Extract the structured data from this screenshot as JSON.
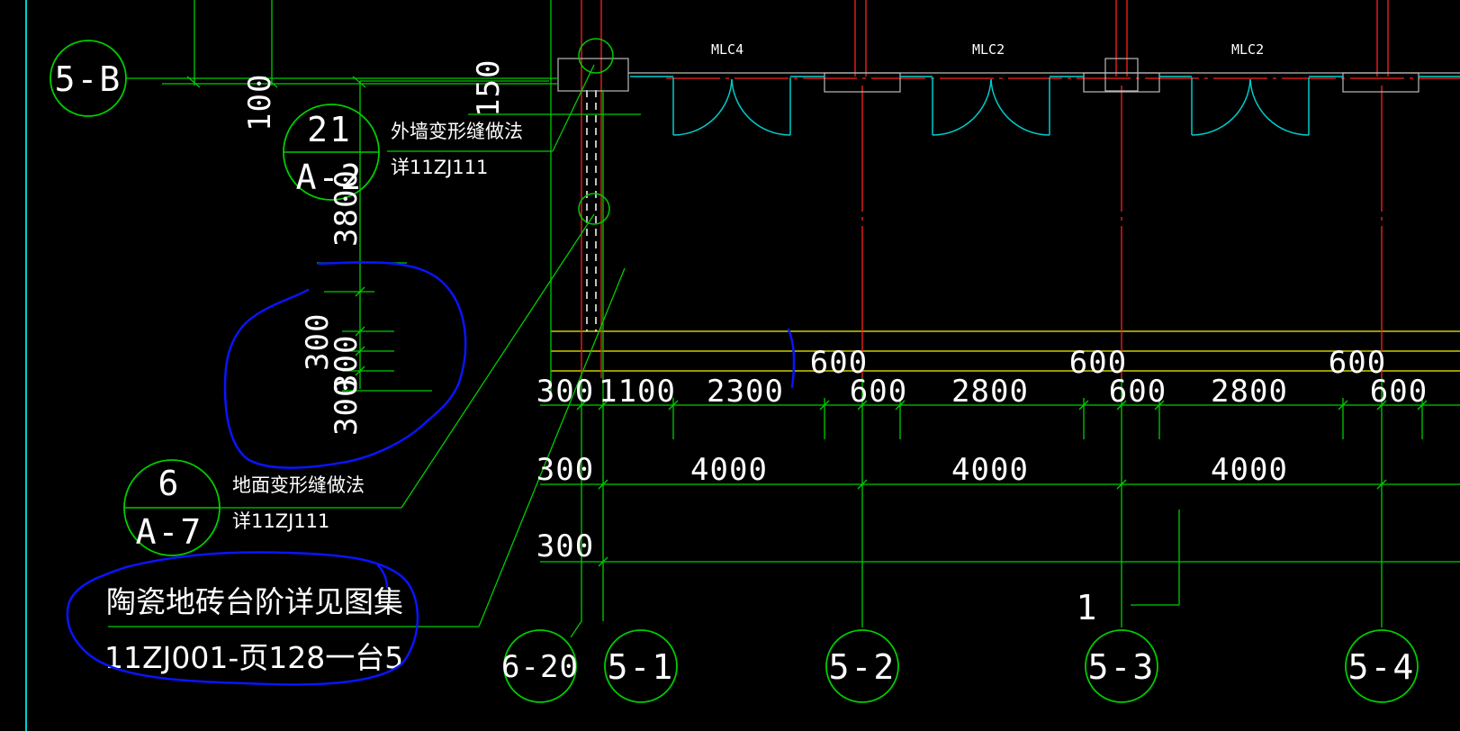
{
  "axis_labels": {
    "b": "5-B",
    "a20": "6-20",
    "a1": "5-1",
    "a2": "5-2",
    "a3": "5-3",
    "a4": "5-4"
  },
  "door_labels": [
    "MLC4",
    "MLC2",
    "MLC2"
  ],
  "detail_callouts": [
    {
      "number": "21",
      "sheet": "A-2",
      "title": "外墙变形缝做法",
      "ref": "详11ZJ111"
    },
    {
      "number": "6",
      "sheet": "A-7",
      "title": "地面变形缝做法",
      "ref": "详11ZJ111"
    }
  ],
  "note": {
    "line1": "陶瓷地砖台阶详见图集",
    "line2": "11ZJ001-页128一台5"
  },
  "vertical_dims": {
    "d100": "100",
    "d150": "150",
    "d3800": "3800",
    "d300a": "300",
    "d300b": "300",
    "d300c": "300"
  },
  "dim_row1": [
    "300",
    "1100",
    "2300",
    "600",
    "2800",
    "600",
    "2800",
    "600"
  ],
  "dim_row_top": [
    "600",
    "600",
    "600"
  ],
  "dim_row2": [
    "300",
    "4000",
    "4000",
    "4000"
  ],
  "dim_row3": [
    "300"
  ],
  "section_mark": "1",
  "colors": {
    "background": "#000000",
    "axis": "#00cc00",
    "door": "#00ffff",
    "center_line": "#ff0000",
    "wall": "#ffff00",
    "markup": "#0000ff",
    "text": "#ffffff",
    "frame": "#00ffff"
  }
}
